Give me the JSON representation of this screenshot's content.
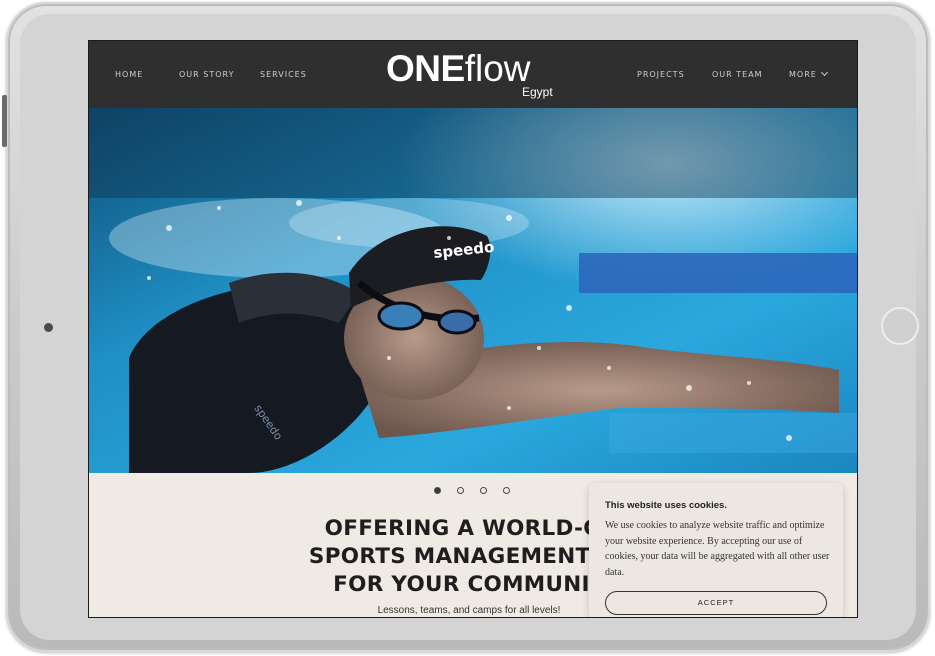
{
  "nav": {
    "left_items": [
      "HOME",
      "OUR STORY",
      "SERVICES"
    ],
    "right_items": [
      "PROJECTS",
      "OUR TEAM",
      "MORE"
    ],
    "logo_main_bold": "ONE",
    "logo_main_light": "flow",
    "logo_sub": "Egypt"
  },
  "hero": {
    "cap_brand": "speedo",
    "suit_brand": "speedo",
    "slide_count": 4,
    "active_slide": 1
  },
  "content": {
    "headline_line1": "OFFERING A WORLD-CL",
    "headline_line2": "SPORTS MANAGEMENT SE",
    "headline_line3": "FOR YOUR COMMUNIT",
    "subline": "Lessons, teams, and camps for all levels!"
  },
  "cookie": {
    "title": "This website uses cookies.",
    "text": "We use cookies to analyze website traffic and optimize your website experience. By accepting our use of cookies, your data will be aggregated with all other user data.",
    "accept_label": "ACCEPT"
  },
  "colors": {
    "nav_bg": "#2f2f2f",
    "page_bg": "#efeae4",
    "water": "#1f8fc4"
  }
}
